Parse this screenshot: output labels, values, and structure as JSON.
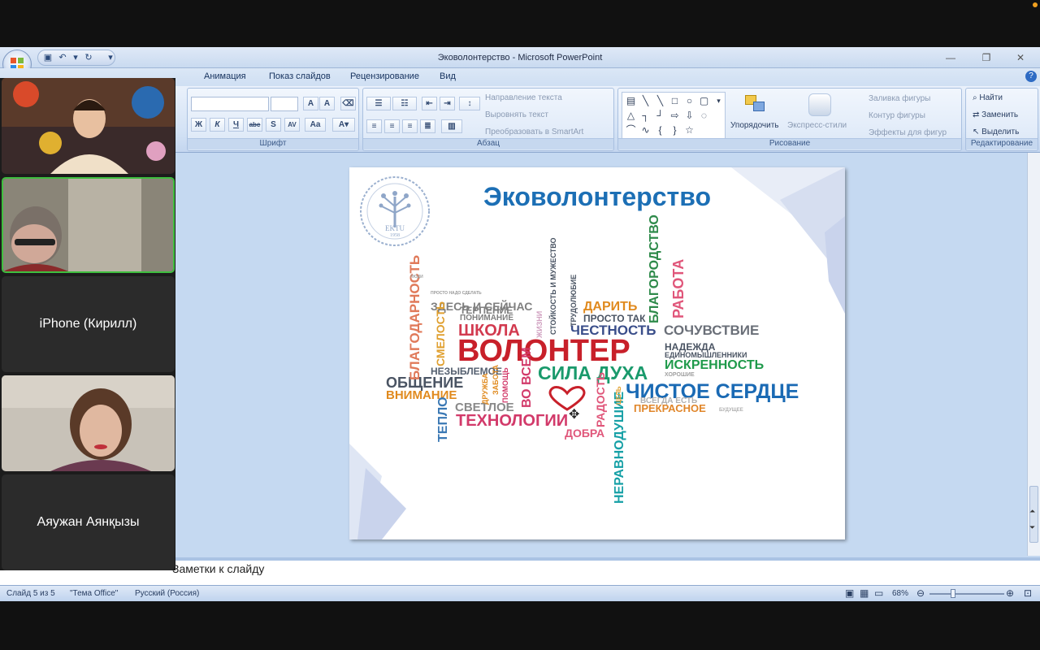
{
  "window": {
    "title": "Эковолонтерство - Microsoft PowerPoint"
  },
  "menu": [
    "Анимация",
    "Показ слайдов",
    "Рецензирование",
    "Вид"
  ],
  "ribbon": {
    "font_group": "Шрифт",
    "paragraph_group": "Абзац",
    "drawing_group": "Рисование",
    "editing_group": "Редактирование",
    "text_direction": "Направление текста",
    "align_text": "Выровнять текст",
    "smartart": "Преобразовать в SmartArt",
    "arrange": "Упорядочить",
    "quick_styles": "Экспресс-стили",
    "shape_fill": "Заливка фигуры",
    "shape_outline": "Контур фигуры",
    "shape_effects": "Эффекты для фигур",
    "find": "Найти",
    "replace": "Заменить",
    "select": "Выделить"
  },
  "slide": {
    "title": "Эковолонтерство",
    "logo_text": "EKTU",
    "logo_year": "1958",
    "cloud": {
      "w01": "ЗДЕСЬ И СЕЙЧАС",
      "w02": "ПРОСТО НАДО СДЕЛАТЬ",
      "w03": "ТЕРПЕНИЕ",
      "w04": "ПОНИМАНИЕ",
      "w05": "ШКОЛА",
      "w06": "ВОЛОНТЕР",
      "w07": "НЕЗЫБЛЕМОЕ",
      "w08": "ОБЩЕНИЕ",
      "w09": "ВНИМАНИЕ",
      "w10": "СВЕТЛОЕ",
      "w11": "ТЕХНОЛОГИИ",
      "w12": "ДОБРА",
      "w13": "СИЛА ДУХА",
      "w14": "ЧИСТОЕ СЕРДЦЕ",
      "w15": "ПРЕКРАСНОЕ",
      "w16": "ИСКРЕННОСТЬ",
      "w17": "НАДЕЖДА",
      "w18": "ЕДИНОМЫШЛЕННИКИ",
      "w19": "СОЧУВСТВИЕ",
      "w20": "ЧЕСТНОСТЬ",
      "w21": "ДАРИТЬ",
      "w22": "ПРОСТО ТАК",
      "w23": "БЛАГОДАРНОСТЬ",
      "w24": "СМЕЛОСТЬ",
      "w25": "ТЕПЛО",
      "w26": "ВО ВСЕМ",
      "w27": "РАДОСТЬ",
      "w28": "НЕРАВНОДУШИЕ",
      "w29": "БЛАГОРОДСТВО",
      "w30": "РАБОТА",
      "w31": "СТОЙКОСТЬ И МУЖЕСТВО",
      "w32": "ТРУДОЛЮБИЕ",
      "w33": "ЖИЗНИ",
      "w34": "ДРУЖБА",
      "w35": "ЗАБОТА",
      "w36": "ПОМОЩЬ",
      "w37": "ЦЕЛЬ",
      "w38": "ВСЕГДА ЕСТЬ",
      "w39": "ХОРОШИЕ",
      "w40": "БУДУЩЕЕ",
      "w41": "ЛЮДИ"
    }
  },
  "notes": {
    "placeholder": "Заметки к слайду"
  },
  "status": {
    "slide_counter": "Слайд 5 из 5",
    "theme": "\"Тема Office\"",
    "language": "Русский (Россия)",
    "zoom": "68%"
  },
  "participants": [
    {
      "name": ""
    },
    {
      "name": ""
    },
    {
      "name": "iPhone (Кирилл)"
    },
    {
      "name": ""
    },
    {
      "name": "Аяужан Аянқызы"
    }
  ],
  "colors": {
    "accent": "#1c6fb5",
    "speaking_border": "#3fbf3f"
  }
}
